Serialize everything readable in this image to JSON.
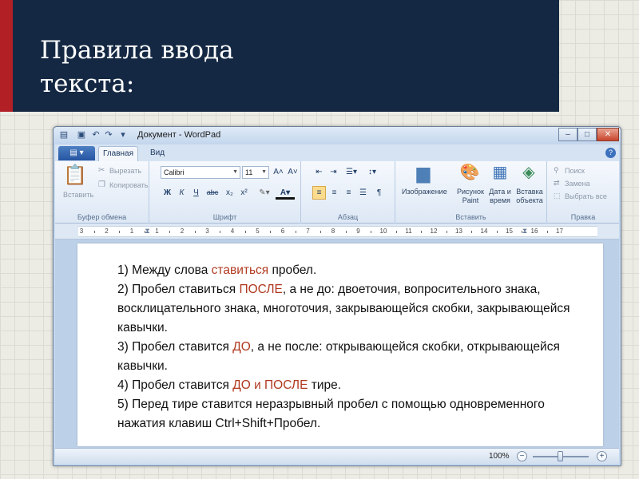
{
  "slide": {
    "title": "Правила ввода\nтекста:"
  },
  "window": {
    "title": "Документ - WordPad",
    "controls": {
      "minimize": "–",
      "maximize": "□",
      "close": "✕"
    }
  },
  "tabs": {
    "app_menu": "▤ ▾",
    "items": [
      {
        "label": "Главная"
      },
      {
        "label": "Вид"
      }
    ],
    "help": "?"
  },
  "ribbon": {
    "clipboard": {
      "paste": "Вставить",
      "cut": "Вырезать",
      "copy": "Копировать",
      "label": "Буфер обмена"
    },
    "font": {
      "family": "Calibri",
      "size": "11",
      "grow": "A˄",
      "shrink": "A˅",
      "bold": "Ж",
      "italic": "К",
      "underline": "Ч",
      "strike": "abc",
      "subscript": "x₂",
      "superscript": "x²",
      "label": "Шрифт"
    },
    "paragraph": {
      "label": "Абзац"
    },
    "insert": {
      "picture": "Изображение",
      "paint": "Рисунок Paint",
      "datetime": "Дата и время",
      "object": "Вставка объекта",
      "label": "Вставить"
    },
    "editing": {
      "find": "Поиск",
      "replace": "Замена",
      "select_all": "Выбрать все",
      "label": "Правка"
    }
  },
  "ruler": {
    "numbers": [
      "3",
      "2",
      "1",
      "1",
      "2",
      "3",
      "4",
      "5",
      "6",
      "7",
      "8",
      "9",
      "10",
      "11",
      "12",
      "13",
      "14",
      "15",
      "16",
      "17"
    ]
  },
  "document": {
    "rules": [
      {
        "parts": [
          {
            "t": "1) Между слова "
          },
          {
            "t": "ставиться",
            "hl": true
          },
          {
            "t": " пробел."
          }
        ]
      },
      {
        "parts": [
          {
            "t": "2) Пробел ставиться "
          },
          {
            "t": "ПОСЛЕ",
            "hl": true
          },
          {
            "t": ", а не до: двоеточия, вопросительного знака, восклицательного знака, многоточия, закрывающейся скобки, закрывающейся кавычки."
          }
        ]
      },
      {
        "parts": [
          {
            "t": "3) Пробел ставится "
          },
          {
            "t": "ДО",
            "hl": true
          },
          {
            "t": ", а не после: открывающейся скобки, открывающейся кавычки."
          }
        ]
      },
      {
        "parts": [
          {
            "t": "4) Пробел ставится "
          },
          {
            "t": "ДО и ПОСЛЕ",
            "hl": true
          },
          {
            "t": " тире."
          }
        ]
      },
      {
        "parts": [
          {
            "t": "5) Перед тире ставится неразрывный пробел с помощью одновременного нажатия клавиш Ctrl+Shift+Пробел."
          }
        ]
      }
    ]
  },
  "status": {
    "zoom": "100%",
    "zoom_out": "−",
    "zoom_in": "+",
    "zoom_level": 0.5
  },
  "colors": {
    "header_bg": "#142843",
    "accent_red": "#b22026",
    "highlight_text": "#b0391f"
  }
}
